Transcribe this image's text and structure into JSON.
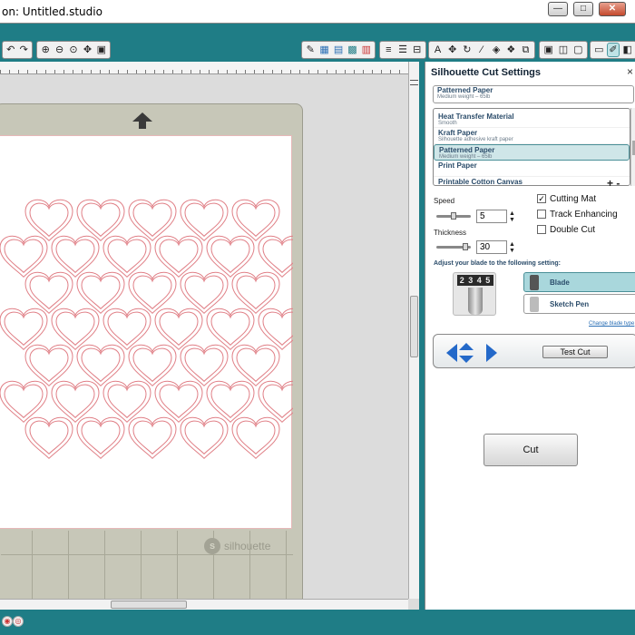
{
  "window": {
    "title": "on: Untitled.studio",
    "minimize": "—",
    "maximize": "□",
    "close": "✕"
  },
  "toolbar": {
    "undo_icon": "undo-icon",
    "redo_icon": "redo-icon",
    "zoom_in_icon": "zoom-in-icon",
    "zoom_out_icon": "zoom-out-icon",
    "zoom_fit_icon": "zoom-fit-icon",
    "pan_icon": "pan-icon",
    "fit_page_icon": "fit-page-icon",
    "text_icon_label": "A"
  },
  "mat": {
    "brand": "silhouette",
    "brand_mark": "s"
  },
  "panel": {
    "title": "Silhouette Cut Settings",
    "close": "×",
    "current_material": {
      "name": "Patterned Paper",
      "sub": "Medium weight – 65lb"
    },
    "materials": [
      {
        "name": "Heat Transfer Material",
        "sub": "Smooth",
        "selected": false
      },
      {
        "name": "Kraft Paper",
        "sub": "Silhouette adhesive kraft paper",
        "selected": false
      },
      {
        "name": "Patterned Paper",
        "sub": "Medium weight – 65lb",
        "selected": true
      },
      {
        "name": "Print Paper",
        "sub": "",
        "selected": false
      },
      {
        "name": "Printable Cotton Canvas",
        "sub": "",
        "selected": false
      }
    ],
    "add_remove": "+ -",
    "speed_label": "Speed",
    "speed_value": "5",
    "speed_level": 0.5,
    "thickness_label": "Thickness",
    "thickness_value": "30",
    "thickness_level": 0.9,
    "spin_up": "▲",
    "spin_down": "▼",
    "cutting_mat_label": "Cutting Mat",
    "cutting_mat_checked": true,
    "track_enhancing_label": "Track Enhancing",
    "track_enhancing_checked": false,
    "double_cut_label": "Double Cut",
    "double_cut_checked": false,
    "blade_prompt": "Adjust your blade to the following setting:",
    "blade_dial": "2 3 4 5",
    "tools": [
      {
        "label": "Blade",
        "selected": true
      },
      {
        "label": "Sketch Pen",
        "selected": false
      }
    ],
    "change_blade_link": "Change blade type",
    "test_cut_label": "Test Cut",
    "cut_label": "Cut"
  },
  "colors": {
    "chrome": "#1f7d86",
    "heart_stroke": "#e07f86",
    "arrow_blue": "#2469c9"
  }
}
